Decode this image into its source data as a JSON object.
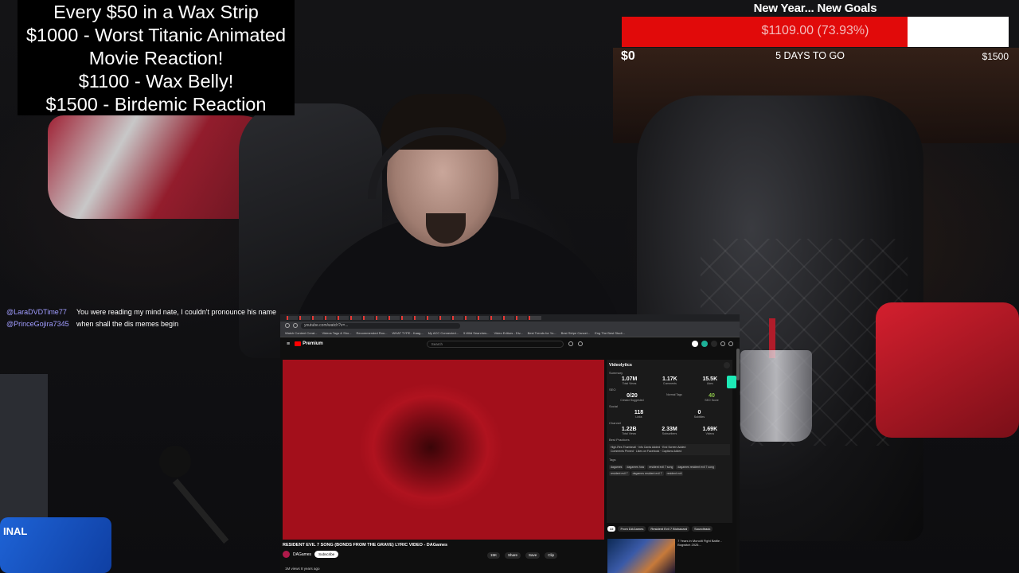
{
  "overlay": {
    "goal_lines": [
      "Every $50 in a Wax Strip",
      "$1000 - Worst Titanic Animated Movie Reaction!",
      "$1100 - Wax Belly!",
      "$1500 - Birdemic Reaction"
    ],
    "progress": {
      "title": "New Year... New Goals",
      "current_text": "$1109.00 (73.93%)",
      "fraction": 0.7393,
      "min_label": "$0",
      "days_label": "5 DAYS TO GO",
      "max_label": "$1500",
      "fill_color": "#e10a0a"
    }
  },
  "chat": [
    {
      "user": "@LaraDVDTime77",
      "message": "You were reading my mind nate, I couldn't pronounce his name"
    },
    {
      "user": "@PrinceGojira7345",
      "message": "when shall the dis memes begin"
    }
  ],
  "webcam": {
    "snack_text": "INAL"
  },
  "browser": {
    "url": "youtube.com/watch?v=...",
    "bookmarks": [
      "Watch Content Creat...",
      "Videos Tags & Sho...",
      "Recommended Roo...",
      "WHAT TYPE - Kaag...",
      "My ACC Connected...",
      "5 Wild Searches...",
      "Video Editors - Div...",
      "Best Trends for Yo...",
      "Best Stripe Cancel...",
      "Eng The Best Studi..."
    ],
    "youtube": {
      "logo": "Premium",
      "search_placeholder": "Search",
      "video_title": "RESIDENT EVIL 7 SONG (BONDS FROM THE GRAVE) LYRIC VIDEO - DAGames",
      "channel": "DAGames",
      "subscribe": "Subscribe",
      "actions": [
        "15K",
        "Share",
        "Save",
        "Clip"
      ],
      "views": "1M views  8 years ago",
      "filters": [
        "All",
        "From DAGames",
        "Resident Evil 7 Biohazard",
        "Soundtrack"
      ],
      "rec_title": "7 Years in Monolit Fight Battle - Bogwitch 2025..."
    },
    "videolytics": {
      "title": "Videolytics",
      "summary_label": "Summary",
      "summary": [
        {
          "value": "1.07M",
          "label": "Total Views"
        },
        {
          "value": "1.17K",
          "label": "Comments"
        },
        {
          "value": "15.5K",
          "label": "Likes"
        }
      ],
      "seo_label": "SEO",
      "seo": [
        {
          "value": "0/20",
          "label": "Creator Suggested"
        },
        {
          "value": "",
          "label": "Normal Tags"
        },
        {
          "value": "40",
          "label": "SEO Score"
        }
      ],
      "social_label": "Social",
      "social": [
        {
          "value": "118",
          "label": "Links"
        },
        {
          "value": "0",
          "label": "Subtitles"
        }
      ],
      "channel_label": "Channel",
      "channel": [
        {
          "value": "1.22B",
          "label": "Total Views"
        },
        {
          "value": "2.33M",
          "label": "Subscribers"
        },
        {
          "value": "1.69K",
          "label": "Videos"
        }
      ],
      "best_practices_label": "Best Practices",
      "best_practices": [
        "High-Res Thumbnail",
        "Info Cards Added",
        "End Screen Added",
        "Comments Pinned",
        "Likes on Facebook",
        "Captions Added"
      ],
      "tags_label": "Tags",
      "tags": [
        "dagames",
        "dagames how",
        "resident evil 7 song",
        "dagames resident evil 7 song",
        "resident evil 7",
        "dagames resident evil 7",
        "resident evil"
      ]
    }
  }
}
